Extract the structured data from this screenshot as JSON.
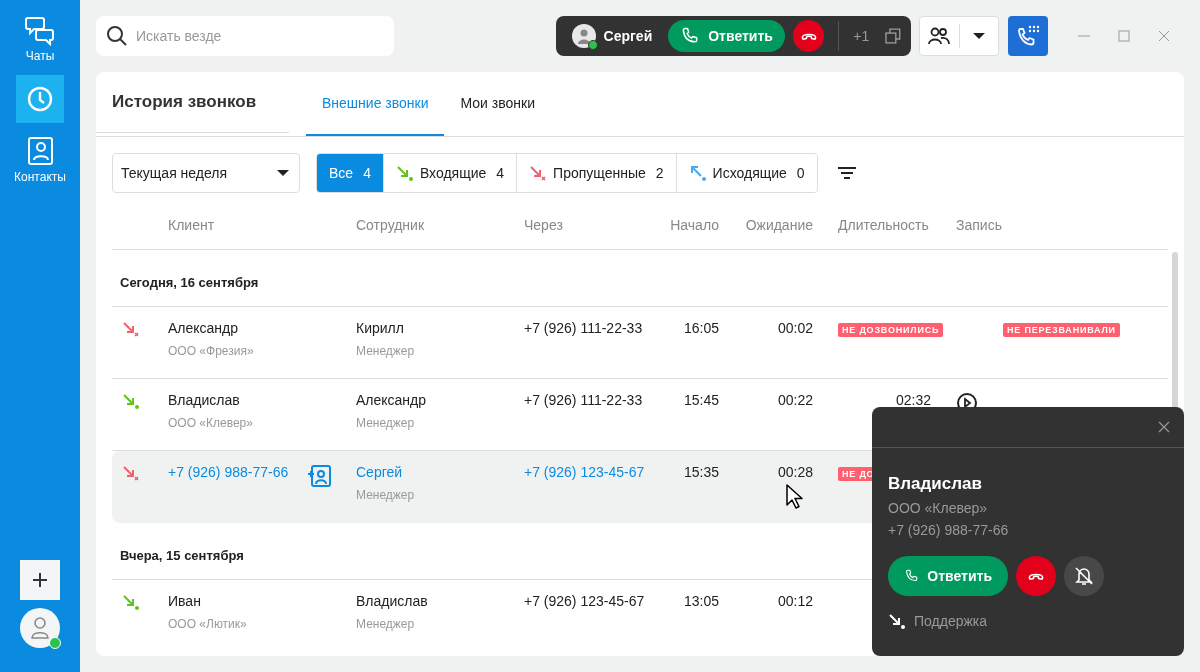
{
  "sidebar": {
    "items": [
      {
        "kind": "chats",
        "label": "Чаты",
        "selected": false
      },
      {
        "kind": "history",
        "selected": true
      },
      {
        "kind": "contacts",
        "label": "Контакты",
        "selected": false
      }
    ]
  },
  "search": {
    "placeholder": "Искать везде"
  },
  "active_call": {
    "caller": "Сергей",
    "answer": "Ответить",
    "extra": "+1"
  },
  "page": {
    "title": "История звонков",
    "tabs": [
      {
        "label": "Внешние звонки",
        "selected": true
      },
      {
        "label": "Мои звонки",
        "selected": false
      }
    ]
  },
  "period": {
    "value": "Текущая неделя"
  },
  "filters": [
    {
      "kind": "all",
      "label": "Все",
      "count": "4",
      "selected": true
    },
    {
      "kind": "incoming",
      "label": "Входящие",
      "count": "4",
      "selected": false
    },
    {
      "kind": "missed",
      "label": "Пропущенные",
      "count": "2",
      "selected": false
    },
    {
      "kind": "outgoing",
      "label": "Исходящие",
      "count": "0",
      "selected": false
    }
  ],
  "table": {
    "columns": [
      "Клиент",
      "Сотрудник",
      "Через",
      "Начало",
      "Ожидание",
      "Длительность",
      "Запись"
    ],
    "groups": [
      {
        "date": "Сегодня, 16 сентября",
        "rows": [
          {
            "kind": "missed",
            "client": "Александр",
            "company": "ООО «Фрезия»",
            "employee": "Кирилл",
            "role": "Менеджер",
            "via": "+7 (926) 111-22-33",
            "start": "16:05",
            "wait": "00:02",
            "duration": {
              "kind": "badge",
              "text": "НЕ ДОЗВОНИЛИСЬ"
            },
            "callback": "НЕ ПЕРЕЗВАНИВАЛИ",
            "recording": false,
            "unknown_client": false,
            "selected": false
          },
          {
            "kind": "incoming",
            "client": "Владислав",
            "company": "ООО «Клевер»",
            "employee": "Александр",
            "role": "Менеджер",
            "via": "+7 (926) 111-22-33",
            "start": "15:45",
            "wait": "00:22",
            "duration": {
              "kind": "time",
              "text": "02:32"
            },
            "recording": true,
            "unknown_client": false,
            "selected": false
          },
          {
            "kind": "missed",
            "client": "+7 (926) 988-77-66",
            "unknown_client": true,
            "employee": "Сергей",
            "role": "Менеджер",
            "via": "+7 (926) 123-45-67",
            "start": "15:35",
            "wait": "00:28",
            "duration": {
              "kind": "badge",
              "text": "НЕ ДО"
            },
            "recording": false,
            "selected": true
          }
        ]
      },
      {
        "date": "Вчера, 15 сентября",
        "rows": [
          {
            "kind": "incoming",
            "client": "Иван",
            "company": "ООО «Лютик»",
            "employee": "Владислав",
            "role": "Менеджер",
            "via": "+7 (926) 123-45-67",
            "start": "13:05",
            "wait": "00:12",
            "unknown_client": false,
            "selected": false
          }
        ]
      }
    ]
  },
  "incoming_popup": {
    "name": "Владислав",
    "company": "ООО «Клевер»",
    "phone": "+7 (926) 988-77-66",
    "answer": "Ответить",
    "line": "Поддержка"
  }
}
